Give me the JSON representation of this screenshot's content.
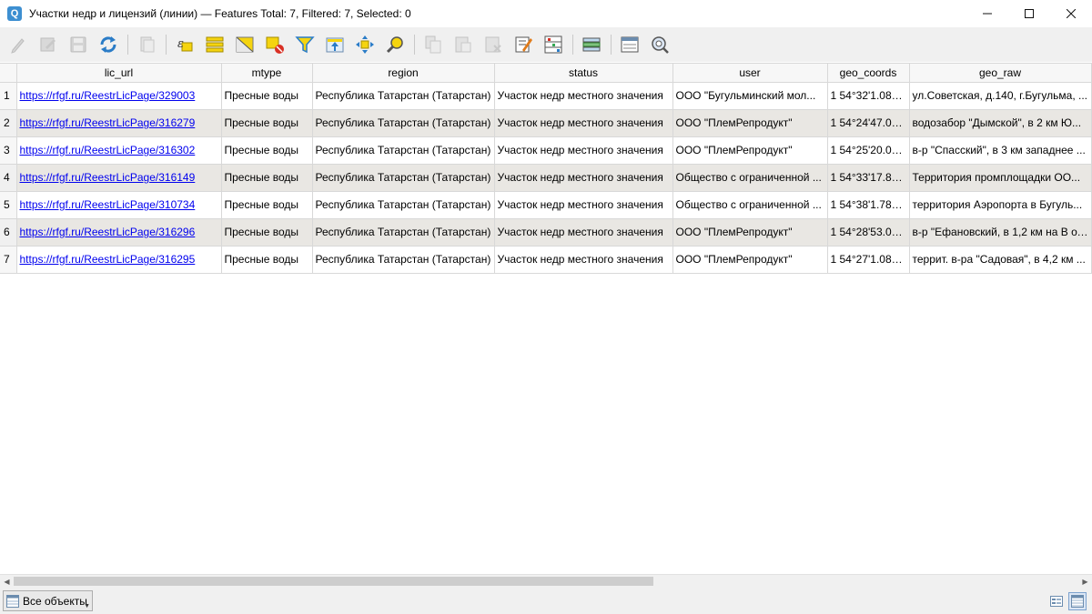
{
  "window": {
    "title": "Участки недр и лицензий (линии) — Features Total: 7, Filtered: 7, Selected: 0",
    "app_icon": "Q",
    "controls": [
      "minimize-icon",
      "maximize-icon",
      "close-icon"
    ]
  },
  "toolbar": {
    "buttons": [
      {
        "name": "toggle-editing-icon",
        "enabled": false
      },
      {
        "name": "toggle-multi-edit-icon",
        "enabled": false
      },
      {
        "name": "save-edits-icon",
        "enabled": false
      },
      {
        "name": "reload-table-icon",
        "enabled": true
      },
      {
        "name": "add-feature-icon",
        "enabled": false
      },
      {
        "name": "select-by-expression-icon",
        "enabled": true
      },
      {
        "name": "select-all-icon",
        "enabled": true
      },
      {
        "name": "invert-selection-icon",
        "enabled": true
      },
      {
        "name": "deselect-all-icon",
        "enabled": true
      },
      {
        "name": "filter-select-icon",
        "enabled": true
      },
      {
        "name": "move-selection-top-icon",
        "enabled": true
      },
      {
        "name": "pan-to-selected-icon",
        "enabled": true
      },
      {
        "name": "zoom-to-selected-icon",
        "enabled": true
      },
      {
        "name": "copy-rows-icon",
        "enabled": false
      },
      {
        "name": "paste-features-icon",
        "enabled": false
      },
      {
        "name": "delete-feature-icon",
        "enabled": false
      },
      {
        "name": "new-field-icon",
        "enabled": true
      },
      {
        "name": "delete-field-icon",
        "enabled": true
      },
      {
        "name": "field-calculator-icon",
        "enabled": true
      },
      {
        "name": "conditional-formatting-icon",
        "enabled": true
      },
      {
        "name": "dock-table-icon",
        "enabled": true
      },
      {
        "name": "actions-icon",
        "enabled": true
      }
    ]
  },
  "table": {
    "columns": [
      "lic_url",
      "mtype",
      "region",
      "status",
      "user",
      "geo_coords",
      "geo_raw"
    ],
    "rows": [
      {
        "n": "1",
        "lic_url": "https://rfgf.ru/ReestrLicPage/329003",
        "mtype": "Пресные воды",
        "region": "Республика Татарстан (Татарстан)",
        "status": "Участок недр местного значения",
        "user": "ООО \"Бугульминский мол...",
        "geo_coords": "1 54°32'1.082...",
        "geo_raw": "ул.Советская, д.140, г.Бугульма, ..."
      },
      {
        "n": "2",
        "lic_url": "https://rfgf.ru/ReestrLicPage/316279",
        "mtype": "Пресные воды",
        "region": "Республика Татарстан (Татарстан)",
        "status": "Участок недр местного значения",
        "user": "ООО \"ПлемРепродукт\"",
        "geo_coords": "1 54°24'47.08...",
        "geo_raw": "водозабор \"Дымской\", в 2 км Ю..."
      },
      {
        "n": "3",
        "lic_url": "https://rfgf.ru/ReestrLicPage/316302",
        "mtype": "Пресные воды",
        "region": "Республика Татарстан (Татарстан)",
        "status": "Участок недр местного значения",
        "user": "ООО \"ПлемРепродукт\"",
        "geo_coords": "1 54°25'20.08...",
        "geo_raw": "в-р \"Спасский\", в 3 км западнее ..."
      },
      {
        "n": "4",
        "lic_url": "https://rfgf.ru/ReestrLicPage/316149",
        "mtype": "Пресные воды",
        "region": "Республика Татарстан (Татарстан)",
        "status": "Участок недр местного значения",
        "user": "Общество с ограниченной ...",
        "geo_coords": "1 54°33'17.89...",
        "geo_raw": "Территория промплощадки ОО..."
      },
      {
        "n": "5",
        "lic_url": "https://rfgf.ru/ReestrLicPage/310734",
        "mtype": "Пресные воды",
        "region": "Республика Татарстан (Татарстан)",
        "status": "Участок недр местного значения",
        "user": "Общество с ограниченной ...",
        "geo_coords": "1 54°38'1.782...",
        "geo_raw": "территория Аэропорта в Бугуль..."
      },
      {
        "n": "6",
        "lic_url": "https://rfgf.ru/ReestrLicPage/316296",
        "mtype": "Пресные воды",
        "region": "Республика Татарстан (Татарстан)",
        "status": "Участок недр местного значения",
        "user": "ООО \"ПлемРепродукт\"",
        "geo_coords": "1 54°28'53.08...",
        "geo_raw": "в-р \"Ефановский, в 1,2 км на В от..."
      },
      {
        "n": "7",
        "lic_url": "https://rfgf.ru/ReestrLicPage/316295",
        "mtype": "Пресные воды",
        "region": "Республика Татарстан (Татарстан)",
        "status": "Участок недр местного значения",
        "user": "ООО \"ПлемРепродукт\"",
        "geo_coords": "1 54°27'1.082...",
        "geo_raw": "террит. в-ра \"Садовая\", в 4,2 км ..."
      }
    ]
  },
  "bottom": {
    "filter_label": "Все объекты",
    "view_buttons": [
      "form-view-icon",
      "table-view-icon"
    ],
    "active_view": "table-view-icon"
  },
  "colors": {
    "link": "#0000ee",
    "alt_row": "#e9e7e3",
    "yellow_icon": "#f5d40f",
    "blue_icon": "#2a7cc7"
  }
}
